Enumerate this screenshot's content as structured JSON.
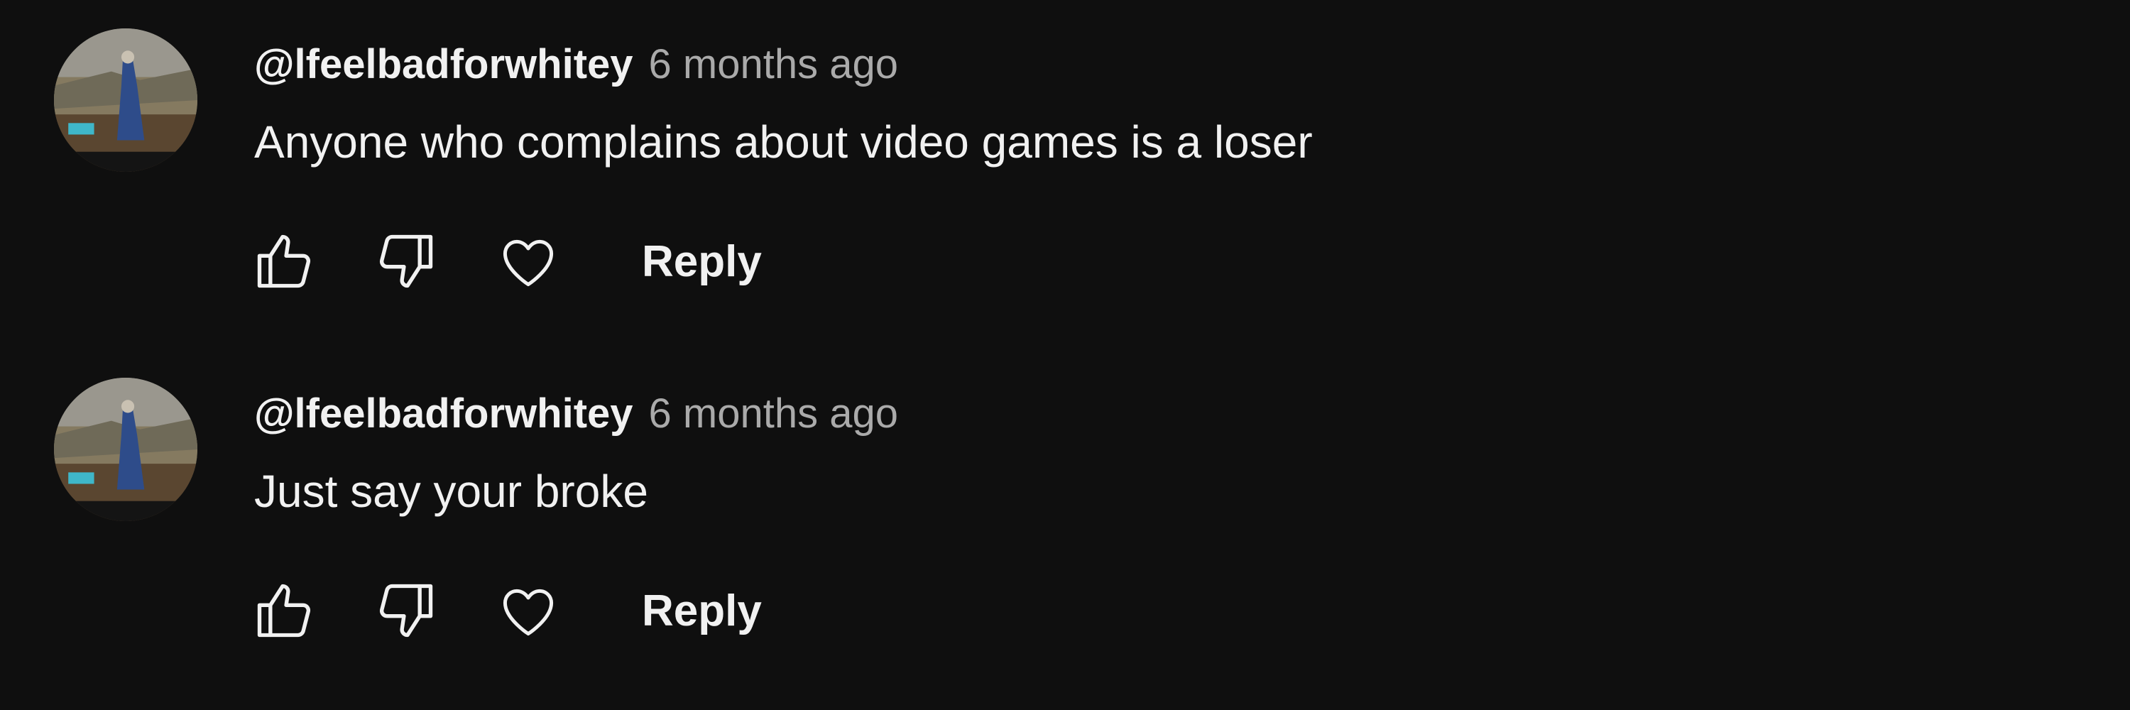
{
  "comments": [
    {
      "author": "@lfeelbadforwhitey",
      "time": "6 months ago",
      "text": "Anyone who complains about video games is a loser",
      "reply_label": "Reply"
    },
    {
      "author": "@lfeelbadforwhitey",
      "time": "6 months ago",
      "text": "Just say your broke",
      "reply_label": "Reply"
    }
  ],
  "colors": {
    "background": "#0f0f0f",
    "primary_text": "#f1f1f1",
    "secondary_text": "#aaaaaa"
  },
  "icons": [
    "thumbs-up-icon",
    "thumbs-down-icon",
    "heart-icon"
  ]
}
